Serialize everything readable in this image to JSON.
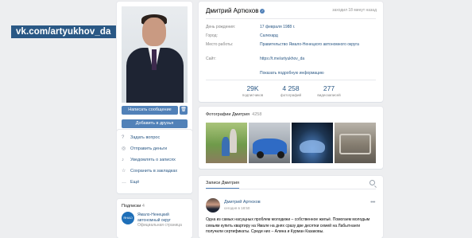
{
  "watermark": "vk.com/artyukhov_da",
  "profile": {
    "name": "Дмитрий Артюхов",
    "last_seen": "заходил 18 минут назад",
    "fields": [
      {
        "key": "День рождения:",
        "value": "17 февраля 1988 г."
      },
      {
        "key": "Город:",
        "value": "Салехард"
      },
      {
        "key": "Место работы:",
        "value": "Правительство Ямало-Ненецкого автономного округа"
      },
      {
        "key": "Сайт:",
        "value": "https://t.me/artyukhov_da"
      }
    ],
    "more_link": "Показать подробную информацию",
    "stats": [
      {
        "number": "29K",
        "label": "подписчиков"
      },
      {
        "number": "4 258",
        "label": "фотографий"
      },
      {
        "number": "277",
        "label": "видеозаписей"
      }
    ]
  },
  "actions": {
    "message_button": "Написать сообщение",
    "friend_button": "Добавить в друзья",
    "delete_icon": "trash-icon"
  },
  "menu": [
    {
      "icon": "question-icon",
      "label": "Задать вопрос"
    },
    {
      "icon": "money-icon",
      "label": "Отправить деньги"
    },
    {
      "icon": "bell-icon",
      "label": "Уведомлять о записях"
    },
    {
      "icon": "star-icon",
      "label": "Сохранить в закладках"
    },
    {
      "icon": "more-icon",
      "label": "Ещё"
    }
  ],
  "subscriptions": {
    "title": "Подписки",
    "count": "4",
    "item_name": "Ямало-Ненецкий автономный округ",
    "item_sub": "Официальная страница"
  },
  "photos": {
    "title": "Фотографии Дмитрия",
    "count": "4258"
  },
  "posts": {
    "tab": "Записи Дмитрия",
    "author": "Дмитрий Артюхов",
    "time": "сегодня в 18:50",
    "text": "Одна из самых насущных проблем молодежи – собственное жильё. Помогаем молодым семьям купить квартиру на Ямале на днях сразу две десятки семей на Лабытнанги получили сертификаты. Среди них – Алина и Курман Казаковы."
  }
}
